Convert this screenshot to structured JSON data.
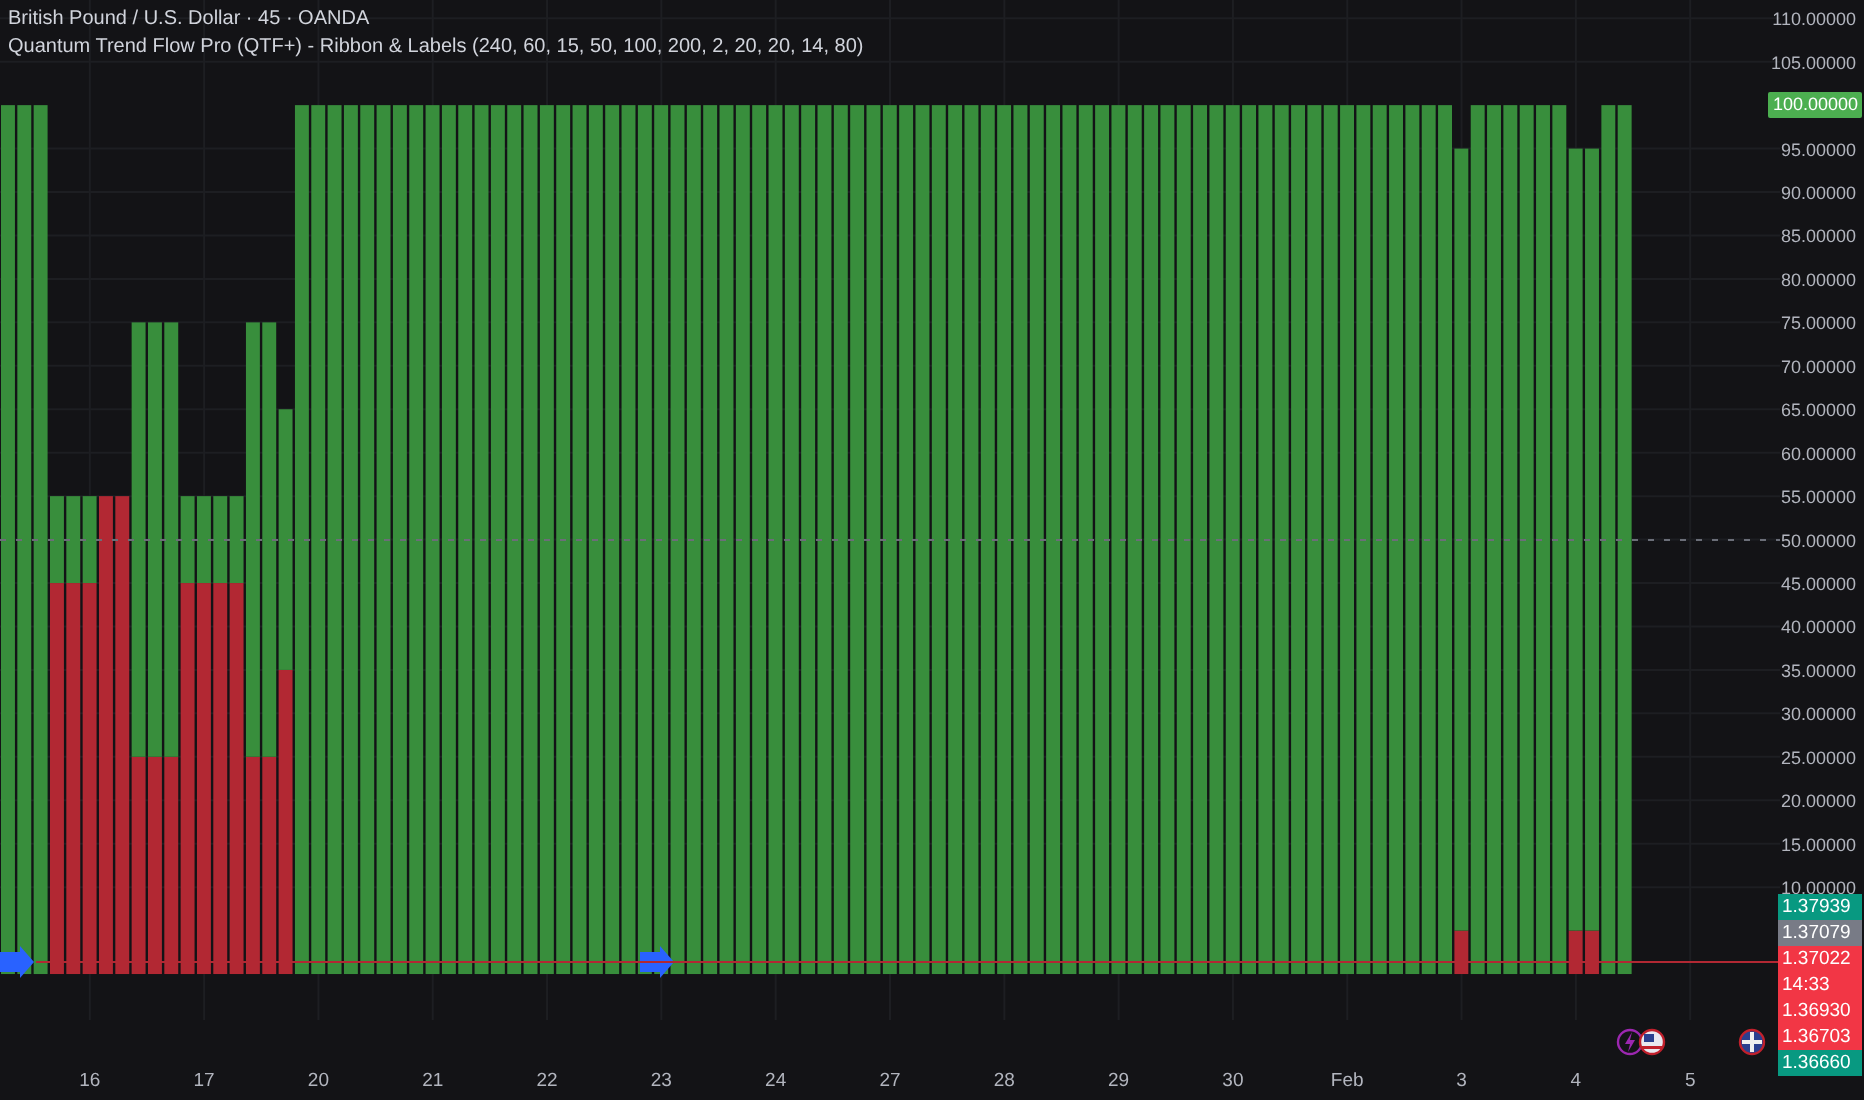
{
  "legend": {
    "symbol": "British Pound / U.S. Dollar · 45 · OANDA",
    "indicator": "Quantum Trend Flow Pro (QTF+) - Ribbon & Labels (240, 60, 15, 50, 100, 200, 2, 20, 20, 14, 80)"
  },
  "chart_data": {
    "type": "bar",
    "stacked": true,
    "categories": [
      null,
      null,
      null,
      null,
      null,
      "16",
      null,
      null,
      null,
      null,
      null,
      null,
      "17",
      null,
      null,
      null,
      null,
      null,
      null,
      "20",
      null,
      null,
      null,
      null,
      null,
      null,
      "21",
      null,
      null,
      null,
      null,
      null,
      null,
      "22",
      null,
      null,
      null,
      null,
      null,
      null,
      "23",
      null,
      null,
      null,
      null,
      null,
      null,
      "24",
      null,
      null,
      null,
      null,
      null,
      null,
      "27",
      null,
      null,
      null,
      null,
      null,
      null,
      "28",
      null,
      null,
      null,
      null,
      null,
      null,
      "29",
      null,
      null,
      null,
      null,
      null,
      null,
      "30",
      null,
      null,
      null,
      null,
      null,
      null,
      "Feb",
      null,
      null,
      null,
      null,
      null,
      null,
      "3",
      null,
      null,
      null,
      null,
      null,
      null,
      "4",
      null,
      null,
      null,
      null,
      null,
      null,
      "5",
      null,
      null,
      null,
      null,
      null
    ],
    "series": [
      {
        "color": "#b22833",
        "values": [
          0,
          0,
          0,
          45,
          45,
          45,
          55,
          55,
          25,
          25,
          25,
          45,
          45,
          45,
          45,
          25,
          25,
          35,
          0,
          0,
          0,
          0,
          0,
          0,
          0,
          0,
          0,
          0,
          0,
          0,
          0,
          0,
          0,
          0,
          0,
          0,
          0,
          0,
          0,
          0,
          0,
          0,
          0,
          0,
          0,
          0,
          0,
          0,
          0,
          0,
          0,
          0,
          0,
          0,
          0,
          0,
          0,
          0,
          0,
          0,
          0,
          0,
          0,
          0,
          0,
          0,
          0,
          0,
          0,
          0,
          0,
          0,
          0,
          0,
          0,
          0,
          0,
          0,
          0,
          0,
          0,
          0,
          0,
          0,
          0,
          0,
          0,
          0,
          0,
          5,
          0,
          0,
          0,
          0,
          0,
          0,
          5,
          5,
          0,
          0,
          null,
          null,
          null,
          null,
          null,
          null,
          null,
          null,
          null
        ]
      },
      {
        "color": "#388e3c",
        "values": [
          100,
          100,
          100,
          10,
          10,
          10,
          0,
          0,
          50,
          50,
          50,
          10,
          10,
          10,
          10,
          50,
          50,
          30,
          100,
          100,
          100,
          100,
          100,
          100,
          100,
          100,
          100,
          100,
          100,
          100,
          100,
          100,
          100,
          100,
          100,
          100,
          100,
          100,
          100,
          100,
          100,
          100,
          100,
          100,
          100,
          100,
          100,
          100,
          100,
          100,
          100,
          100,
          100,
          100,
          100,
          100,
          100,
          100,
          100,
          100,
          100,
          100,
          100,
          100,
          100,
          100,
          100,
          100,
          100,
          100,
          100,
          100,
          100,
          100,
          100,
          100,
          100,
          100,
          100,
          100,
          100,
          100,
          100,
          100,
          100,
          100,
          100,
          100,
          100,
          90,
          100,
          100,
          100,
          100,
          100,
          100,
          90,
          90,
          100,
          100,
          null,
          null,
          null,
          null,
          null,
          null,
          null,
          null,
          null
        ]
      }
    ],
    "ylim": [
      -5.29,
      112.1
    ],
    "grid": true,
    "yticks": [
      {
        "value": 10,
        "label": "10.00000"
      },
      {
        "value": 15,
        "label": "15.00000"
      },
      {
        "value": 20,
        "label": "20.00000"
      },
      {
        "value": 25,
        "label": "25.00000"
      },
      {
        "value": 30,
        "label": "30.00000"
      },
      {
        "value": 35,
        "label": "35.00000"
      },
      {
        "value": 40,
        "label": "40.00000"
      },
      {
        "value": 45,
        "label": "45.00000"
      },
      {
        "value": 50,
        "label": "50.00000"
      },
      {
        "value": 55,
        "label": "55.00000"
      },
      {
        "value": 60,
        "label": "60.00000"
      },
      {
        "value": 65,
        "label": "65.00000"
      },
      {
        "value": 70,
        "label": "70.00000"
      },
      {
        "value": 75,
        "label": "75.00000"
      },
      {
        "value": 80,
        "label": "80.00000"
      },
      {
        "value": 85,
        "label": "85.00000"
      },
      {
        "value": 90,
        "label": "90.00000"
      },
      {
        "value": 95,
        "label": "95.00000"
      },
      {
        "value": 105,
        "label": "105.00000"
      },
      {
        "value": 110,
        "label": "110.00000"
      }
    ]
  },
  "indicator_value": {
    "text": "100.00000",
    "color": "#4caf50"
  },
  "price_tags": [
    {
      "price": "1.37939",
      "color": "#089981"
    },
    {
      "price": "1.37079",
      "color": "#787b86"
    },
    {
      "price": "1.37022",
      "countdown": "14:33",
      "color": "#f23645"
    },
    {
      "price": "1.36930",
      "color": "#f23645"
    },
    {
      "price": "1.36703",
      "color": "#f23645"
    },
    {
      "price": "1.36660",
      "color": "#089981"
    }
  ]
}
